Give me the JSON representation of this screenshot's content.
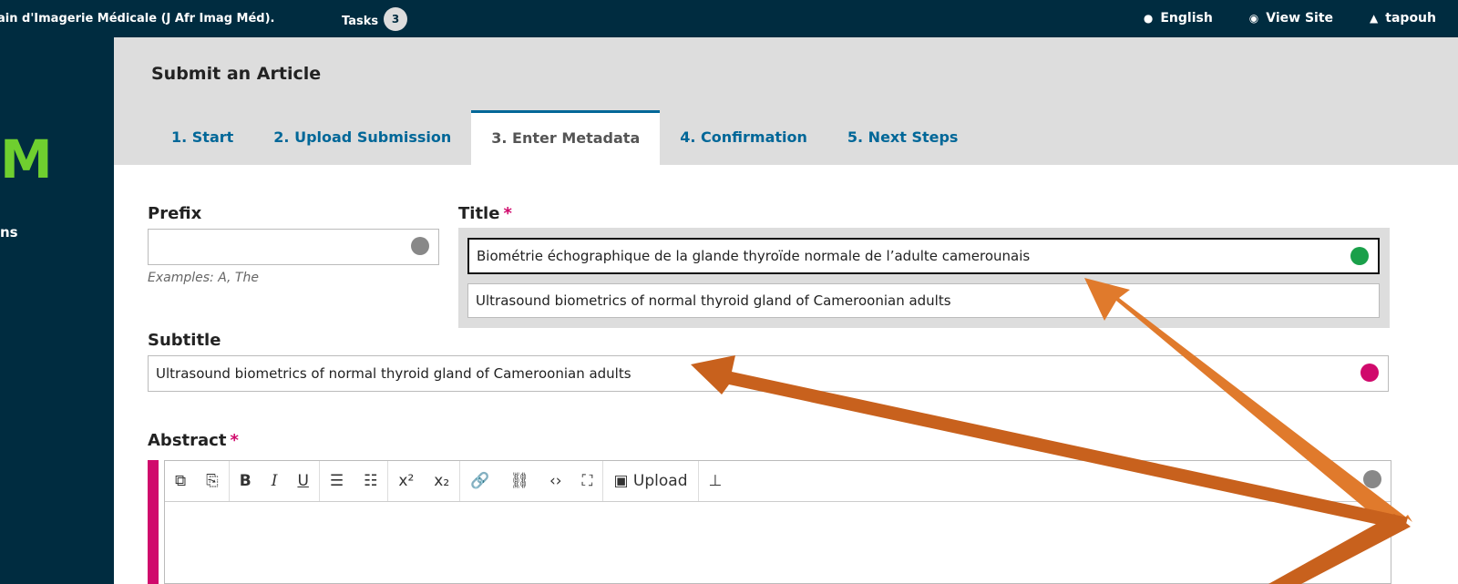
{
  "topbar": {
    "context": "ain d'Imagerie Médicale (J Afr Imag Méd).",
    "tasks_label": "Tasks",
    "tasks_count": "3",
    "language": "English",
    "view_site": "View Site",
    "user": "tapouh"
  },
  "sidebar": {
    "logo": "M",
    "item": "ns"
  },
  "page": {
    "title": "Submit an Article"
  },
  "tabs": [
    "1. Start",
    "2. Upload Submission",
    "3. Enter Metadata",
    "4. Confirmation",
    "5. Next Steps"
  ],
  "form": {
    "prefix_label": "Prefix",
    "prefix_value": "",
    "prefix_hint": "Examples: A, The",
    "title_label": "Title",
    "required_mark": "*",
    "title_value_fr": "Biométrie échographique de la glande thyroïde normale de l’adulte camerounais",
    "title_value_en": "Ultrasound biometrics of normal thyroid gland of Cameroonian adults",
    "subtitle_label": "Subtitle",
    "subtitle_value": "Ultrasound biometrics of normal thyroid gland of Cameroonian adults",
    "abstract_label": "Abstract"
  },
  "editor": {
    "buttons": [
      "copy-icon",
      "paste-icon",
      "bold-icon",
      "italic-icon",
      "underline-icon",
      "bullet-list-icon",
      "numbered-list-icon",
      "superscript-icon",
      "subscript-icon",
      "link-icon",
      "unlink-icon",
      "code-icon",
      "fullscreen-icon",
      "image-icon",
      "insert-icon"
    ],
    "upload_label": "Upload"
  },
  "colors": {
    "topbar": "#002c40",
    "accent": "#006798",
    "required": "#d00a6c",
    "arrow": "#e07a2c"
  }
}
